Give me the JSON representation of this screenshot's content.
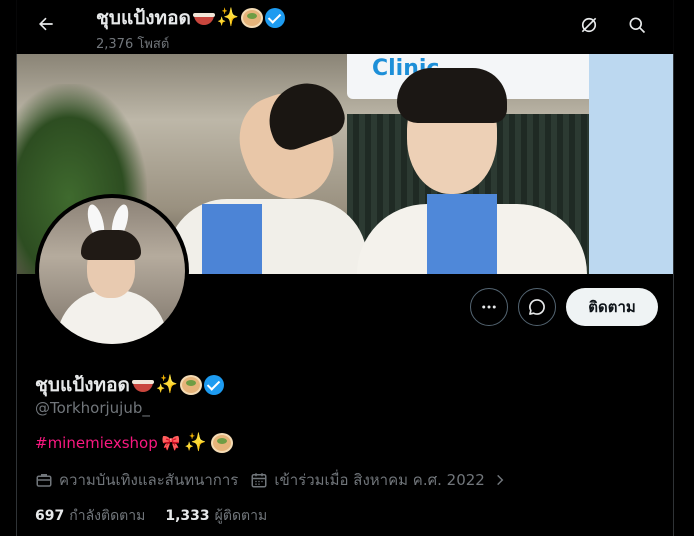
{
  "header": {
    "title": "ชุบแป้งทอด",
    "post_count": "2,376 โพสต์"
  },
  "banner": {
    "sign_text": "Clinic"
  },
  "profile": {
    "display_name": "ชุบแป้งทอด",
    "handle": "@Torkhorjujub_",
    "bio_hashtag": "#minemiexshop",
    "category": "ความบันเทิงและสันทนาการ",
    "joined": "เข้าร่วมเมื่อ สิงหาคม ค.ศ. 2022",
    "follow_label": "ติดตาม"
  },
  "stats": {
    "following_count": "697",
    "following_label": "กำลังติดตาม",
    "followers_count": "1,333",
    "followers_label": "ผู้ติดตาม"
  },
  "colors": {
    "background": "#000000",
    "verified": "#1d9bf0",
    "hashtag": "#f91880",
    "muted": "#71767b",
    "follow_button_bg": "#eff3f4"
  },
  "icons": {
    "back": "arrow-left-icon",
    "rotate": "rotate-off-icon",
    "search": "search-icon",
    "more": "more-dots-icon",
    "message": "chat-bubble-icon",
    "category": "briefcase-icon",
    "calendar": "calendar-icon",
    "verified": "verified-badge-icon"
  }
}
